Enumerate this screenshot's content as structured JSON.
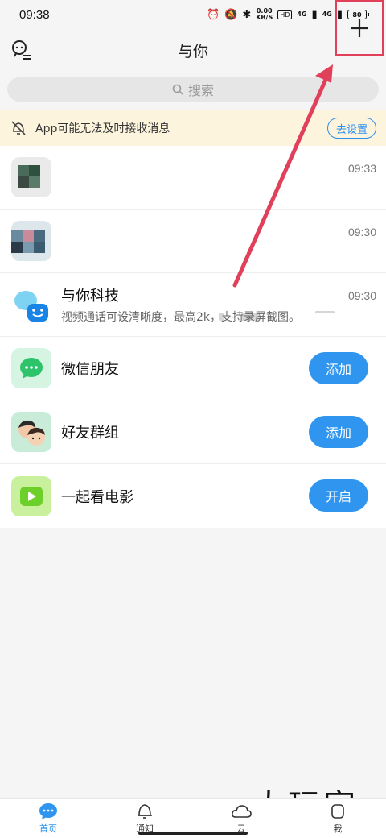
{
  "status": {
    "time": "09:38",
    "net_speed": "0.00",
    "net_unit": "KB/S",
    "hd_label": "HD",
    "signal1": "4G",
    "signal2": "4G",
    "battery": "80"
  },
  "header": {
    "title": "与你",
    "left_icon": "profile-menu-icon",
    "right_icon": "plus-icon"
  },
  "search": {
    "placeholder": "搜索",
    "icon": "search-icon"
  },
  "notice": {
    "text": "App可能无法及时接收消息",
    "button": "去设置",
    "icon": "muted-bell-icon"
  },
  "chats": [
    {
      "time": "09:33"
    },
    {
      "time": "09:30"
    },
    {
      "title": "与你科技",
      "preview": "视频通话可设清晰度，最高2k，支持录屏截图。",
      "time": "09:30"
    }
  ],
  "features": [
    {
      "title": "微信朋友",
      "button": "添加",
      "icon": "wechat-icon",
      "color": "#2cc36b"
    },
    {
      "title": "好友群组",
      "button": "添加",
      "icon": "group-avatars-icon",
      "color": "#c9ecd9"
    },
    {
      "title": "一起看电影",
      "button": "开启",
      "icon": "play-icon",
      "color": "#7cd63a"
    }
  ],
  "nav": [
    {
      "label": "首页",
      "icon": "chat-bubble-icon"
    },
    {
      "label": "通知",
      "icon": "bell-icon"
    },
    {
      "label": "云",
      "icon": "cloud-icon"
    },
    {
      "label": "我",
      "icon": "person-icon"
    }
  ],
  "watermark": "大玩家",
  "colors": {
    "accent": "#2f95ef",
    "annotation": "#e0405a",
    "notice_bg": "#fdf4de"
  }
}
